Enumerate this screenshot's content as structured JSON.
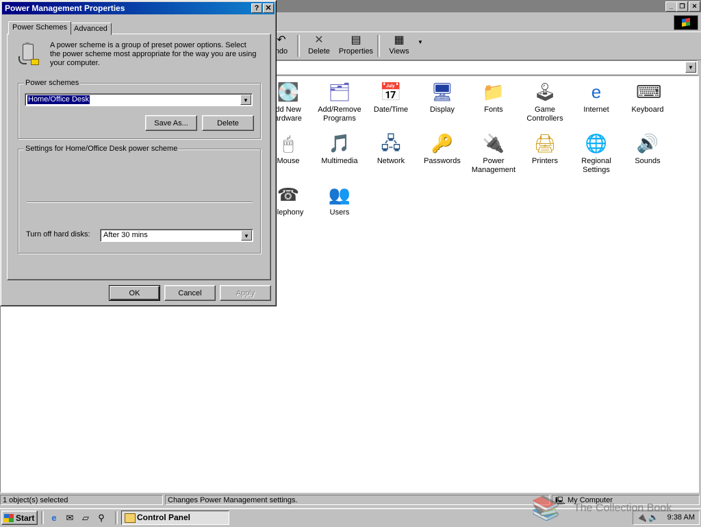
{
  "dialog": {
    "title": "Power Management Properties",
    "help_btn": "?",
    "close_btn": "✕",
    "tabs": [
      "Power Schemes",
      "Advanced"
    ],
    "description": "A power scheme is a group of preset power options. Select the power scheme most appropriate for the way you are using your computer.",
    "schemes_group_label": "Power schemes",
    "scheme_value": "Home/Office Desk",
    "save_as_label": "Save As...",
    "delete_label": "Delete",
    "settings_group_label": "Settings for Home/Office Desk power scheme",
    "hard_disks_label": "Turn off hard disks:",
    "hard_disks_value": "After 30 mins",
    "ok_label": "OK",
    "cancel_label": "Cancel",
    "apply_label": "Apply"
  },
  "explorer": {
    "toolbar": [
      {
        "label": "ndo",
        "icon": "undo-icon",
        "glyph": "↶"
      },
      {
        "label": "Delete",
        "icon": "delete-x-icon",
        "glyph": "✕"
      },
      {
        "label": "Properties",
        "icon": "properties-icon",
        "glyph": "▤"
      },
      {
        "label": "Views",
        "icon": "views-icon",
        "glyph": "▦"
      }
    ],
    "items": [
      {
        "label": "dd New\nardware",
        "icon": "add-hardware-icon",
        "glyph": "💽",
        "color": "#2a8a2a"
      },
      {
        "label": "Add/Remove\nPrograms",
        "icon": "add-remove-programs-icon",
        "glyph": "🗂",
        "color": "#6060c0"
      },
      {
        "label": "Date/Time",
        "icon": "date-time-icon",
        "glyph": "📅",
        "color": "#c03030"
      },
      {
        "label": "Display",
        "icon": "display-icon",
        "glyph": "🖥",
        "color": "#2040a0"
      },
      {
        "label": "Fonts",
        "icon": "fonts-folder-icon",
        "glyph": "📁",
        "color": "#d0a020"
      },
      {
        "label": "Game\nControllers",
        "icon": "joystick-icon",
        "glyph": "🕹",
        "color": "#505050"
      },
      {
        "label": "Internet",
        "icon": "internet-icon",
        "glyph": "e",
        "color": "#1e6cd0"
      },
      {
        "label": "Keyboard",
        "icon": "keyboard-icon",
        "glyph": "⌨",
        "color": "#404040"
      },
      {
        "label": "Mouse",
        "icon": "mouse-icon",
        "glyph": "🖱",
        "color": "#606060"
      },
      {
        "label": "Multimedia",
        "icon": "multimedia-icon",
        "glyph": "🎵",
        "color": "#404080"
      },
      {
        "label": "Network",
        "icon": "network-icon",
        "glyph": "🖧",
        "color": "#205080"
      },
      {
        "label": "Passwords",
        "icon": "passwords-key-icon",
        "glyph": "🔑",
        "color": "#b08010"
      },
      {
        "label": "Power\nManagement",
        "icon": "power-management-icon",
        "glyph": "🔌",
        "color": "#606060"
      },
      {
        "label": "Printers",
        "icon": "printers-folder-icon",
        "glyph": "🖨",
        "color": "#d0a020"
      },
      {
        "label": "Regional\nSettings",
        "icon": "globe-icon",
        "glyph": "🌐",
        "color": "#208020"
      },
      {
        "label": "Sounds",
        "icon": "sounds-icon",
        "glyph": "🔊",
        "color": "#404080"
      },
      {
        "label": "elephony",
        "icon": "telephony-icon",
        "glyph": "☎",
        "color": "#404040"
      },
      {
        "label": "Users",
        "icon": "users-icon",
        "glyph": "👥",
        "color": "#802020"
      }
    ],
    "status_left": "1 object(s) selected",
    "status_mid": "Changes Power Management settings.",
    "status_right": "My Computer"
  },
  "taskbar": {
    "start_label": "Start",
    "task_label": "Control Panel",
    "clock": "9:38 AM"
  },
  "watermark": "The Collection Book"
}
